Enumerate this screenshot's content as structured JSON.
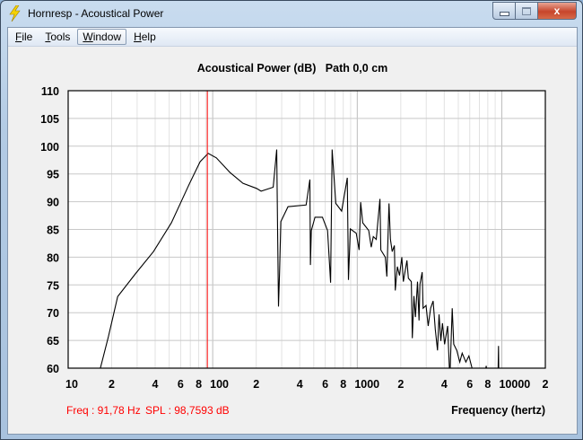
{
  "window": {
    "title": "Hornresp - Acoustical Power",
    "min_icon": "minimize-icon",
    "max_icon": "maximize-icon",
    "close_icon": "close-icon",
    "close_glyph": "x"
  },
  "menu": [
    {
      "label": "File",
      "u": "F",
      "rest": "ile"
    },
    {
      "label": "Tools",
      "u": "T",
      "rest": "ools"
    },
    {
      "label": "Window",
      "u": "W",
      "rest": "indow"
    },
    {
      "label": "Help",
      "u": "H",
      "rest": "elp"
    }
  ],
  "status": {
    "freq": "Freq : 91,78 Hz",
    "spl": "SPL : 98,7593 dB"
  },
  "colors": {
    "cursor": "#ff0000",
    "curve": "#000000",
    "grid": "#c8c8c8"
  },
  "chart_data": {
    "type": "line",
    "title": "Acoustical Power (dB)   Path 0,0 cm",
    "xlabel": "Frequency (hertz)",
    "ylabel": "",
    "xscale": "log",
    "xlim": [
      10,
      20000
    ],
    "ylim": [
      60,
      110
    ],
    "grid": true,
    "yticks": [
      "110",
      "105",
      "100",
      "95",
      "90",
      "85",
      "80",
      "75",
      "70",
      "65",
      "60"
    ],
    "xticks": [
      {
        "v": 10,
        "t": "10"
      },
      {
        "v": 20,
        "t": "2"
      },
      {
        "v": 40,
        "t": "4"
      },
      {
        "v": 60,
        "t": "6"
      },
      {
        "v": 80,
        "t": "8"
      },
      {
        "v": 100,
        "t": "100"
      },
      {
        "v": 200,
        "t": "2"
      },
      {
        "v": 400,
        "t": "4"
      },
      {
        "v": 600,
        "t": "6"
      },
      {
        "v": 800,
        "t": "8"
      },
      {
        "v": 1000,
        "t": "1000"
      },
      {
        "v": 2000,
        "t": "2"
      },
      {
        "v": 4000,
        "t": "4"
      },
      {
        "v": 6000,
        "t": "6"
      },
      {
        "v": 8000,
        "t": "8"
      },
      {
        "v": 10000,
        "t": "10000"
      },
      {
        "v": 20000,
        "t": "2"
      }
    ],
    "cursor": {
      "freq": 91.78,
      "spl": 98.7593
    },
    "series": [
      {
        "name": "Acoustical Power",
        "x": [
          14.3,
          16.7,
          19.0,
          22.0,
          29.2,
          38.9,
          51.8,
          68.9,
          81.8,
          93,
          106,
          131,
          162,
          201,
          216,
          262,
          277,
          281,
          285,
          290,
          296,
          332,
          443,
          470,
          474,
          481,
          510,
          574,
          623,
          654,
          670,
          710,
          780,
          853,
          869,
          895,
          984,
          1030,
          1055,
          1091,
          1201,
          1249,
          1291,
          1354,
          1434,
          1455,
          1563,
          1602,
          1657,
          1697,
          1746,
          1805,
          1832,
          1894,
          1958,
          2034,
          2082,
          2205,
          2258,
          2367,
          2403,
          2465,
          2525,
          2610,
          2676,
          2715,
          2813,
          2854,
          2990,
          3093,
          3217,
          3350,
          3466,
          3590,
          3677,
          3788,
          3884,
          4018,
          4220,
          4366,
          4538,
          4650,
          4880,
          5120,
          5320,
          5640,
          5920,
          6370,
          6800,
          7500,
          7800,
          8100,
          9000,
          9400,
          9485,
          9550,
          10500,
          12000
        ],
        "y": [
          52,
          60,
          65.7,
          72.9,
          77.0,
          81.0,
          86.2,
          93.2,
          97.2,
          98.7,
          97.9,
          95.3,
          93.3,
          92.4,
          91.9,
          92.6,
          99.4,
          84.8,
          71.1,
          77.3,
          86.4,
          89.1,
          89.4,
          94.0,
          78.6,
          84.8,
          87.2,
          87.2,
          84.8,
          75.4,
          99.4,
          89.7,
          88.3,
          94.3,
          75.9,
          85.1,
          84.3,
          81.3,
          89.9,
          86.2,
          84.8,
          81.8,
          83.7,
          83.2,
          90.5,
          81.3,
          80.0,
          76.5,
          89.7,
          83.2,
          81.0,
          82.1,
          74.0,
          78.3,
          76.7,
          80.0,
          75.6,
          79.4,
          76.2,
          75.6,
          65.4,
          73.0,
          69.2,
          75.6,
          68.6,
          75.1,
          77.3,
          70.8,
          71.3,
          67.6,
          70.8,
          72.1,
          67.0,
          63.2,
          69.7,
          64.9,
          68.1,
          64.3,
          67.6,
          58,
          70.8,
          64.3,
          63.2,
          61.1,
          62.7,
          61.1,
          62.2,
          59,
          57,
          58,
          60.4,
          57,
          56,
          58,
          64,
          56,
          55,
          50
        ]
      }
    ]
  }
}
